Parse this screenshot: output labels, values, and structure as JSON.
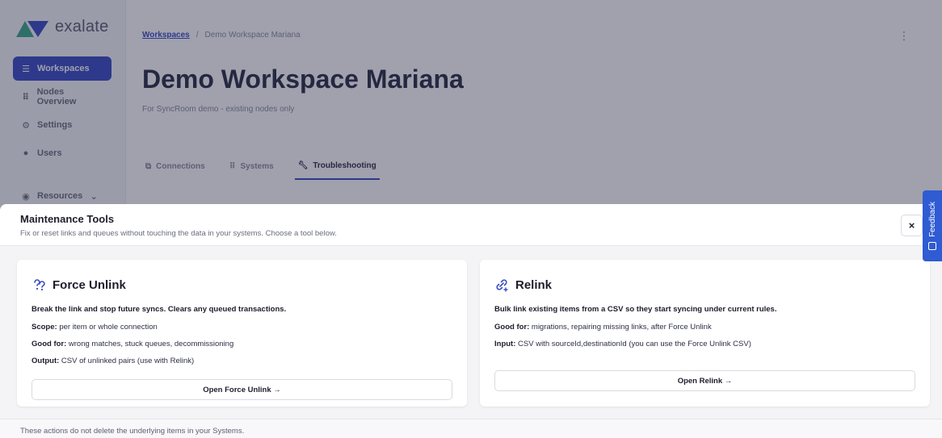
{
  "app": {
    "logo_text": "exalate",
    "nav": [
      {
        "label": "Workspaces",
        "icon": "grid-icon",
        "active": true
      },
      {
        "label": "Nodes Overview",
        "icon": "nodes-icon"
      },
      {
        "label": "Settings",
        "icon": "gear-icon"
      },
      {
        "label": "Users",
        "icon": "user-icon"
      },
      {
        "label": "Resources",
        "icon": "book-icon"
      }
    ],
    "breadcrumb": {
      "link": "Workspaces",
      "separator": "/",
      "current": "Demo Workspace Mariana"
    },
    "page_title": "Demo Workspace Mariana",
    "page_subtitle": "For SyncRoom demo - existing nodes only",
    "tabs": [
      {
        "label": "Connections",
        "icon": "connections-icon"
      },
      {
        "label": "Systems",
        "icon": "grid-icon"
      },
      {
        "label": "Troubleshooting",
        "icon": "wrench-icon",
        "active": true
      }
    ]
  },
  "panel": {
    "title": "Maintenance Tools",
    "subtitle": "Fix or reset links and queues without touching the data in your systems. Choose a tool below.",
    "close_label": "×",
    "footer_text": "These actions do not delete the underlying items in your Systems."
  },
  "force_unlink": {
    "icon": "unlink-icon",
    "title": "Force Unlink",
    "lead": "Break the link and stop future syncs. Clears any queued transactions.",
    "scope_label": "Scope:",
    "scope_value": " per item or whole connection",
    "good_label": "Good for:",
    "good_value": " wrong matches, stuck queues, decommissioning",
    "output_label": "Output:",
    "output_value": " CSV of unlinked pairs (use with Relink)",
    "button": "Open Force Unlink →"
  },
  "relink": {
    "icon": "link-icon",
    "title": "Relink",
    "lead": "Bulk link existing items from a CSV so they start syncing under current rules.",
    "good_label": "Good for:",
    "good_value": " migrations, repairing missing links, after Force Unlink",
    "input_label": "Input:",
    "input_value": " CSV with sourceId,destinationId (you can use the Force Unlink CSV)",
    "button": "Open Relink →"
  },
  "feedback": {
    "label": "Feedback"
  },
  "colors": {
    "accent": "#3b4dc4",
    "feedback": "#2f5bd3",
    "overlay": "rgba(28,32,60,0.42)"
  }
}
